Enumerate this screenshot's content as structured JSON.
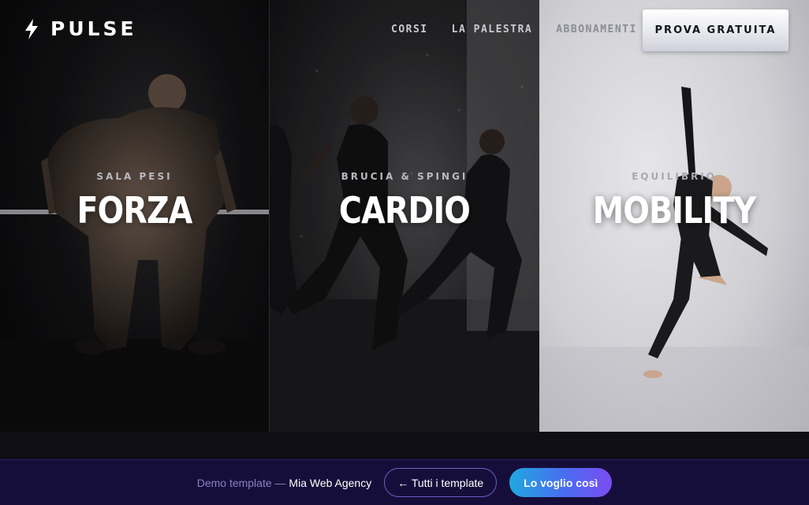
{
  "brand": {
    "name": "PULSE",
    "icon": "bolt-icon"
  },
  "nav": {
    "links": [
      {
        "label": "CORSI"
      },
      {
        "label": "LA PALESTRA"
      },
      {
        "label": "ABBONAMENTI"
      }
    ],
    "cta_label": "PROVA GRATUITA"
  },
  "panels": [
    {
      "subtitle": "SALA PESI",
      "title": "FORZA",
      "image": "weightlifter-photo"
    },
    {
      "subtitle": "BRUCIA & SPINGI",
      "title": "CARDIO",
      "image": "runners-photo"
    },
    {
      "subtitle": "EQUILIBRIO",
      "title": "MOBILITY",
      "image": "dancer-photo"
    }
  ],
  "demo_bar": {
    "text": "Demo template —",
    "agency": "Mia Web Agency",
    "back_label": "← Tutti i template",
    "cta_label": "Lo voglio così"
  },
  "colors": {
    "accent_bar": "#160e3a",
    "cta_gradient_start": "#1fa8e0",
    "cta_gradient_end": "#7a4cf0"
  }
}
